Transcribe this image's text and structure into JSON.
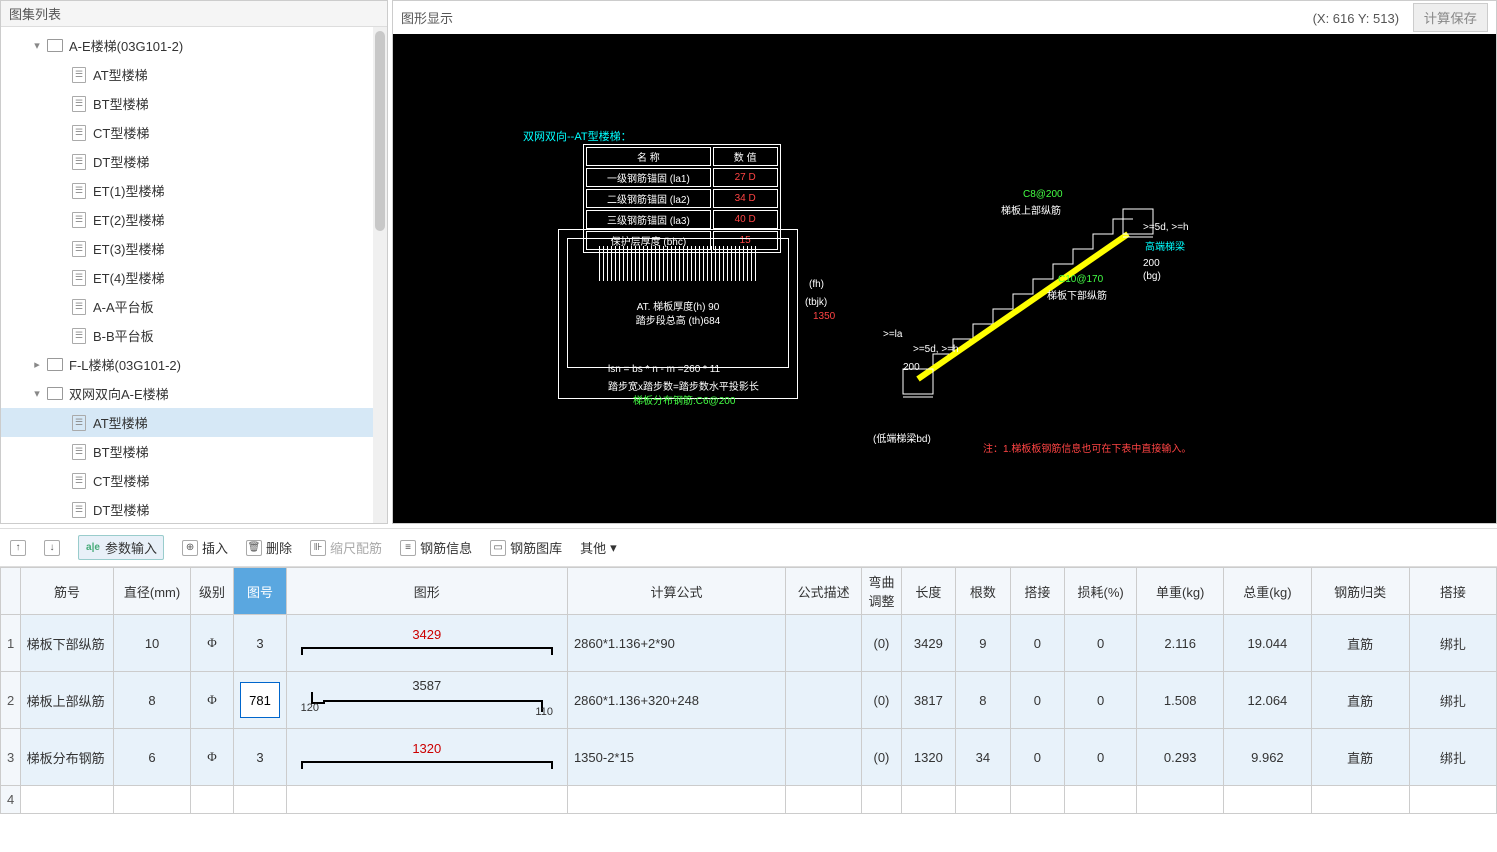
{
  "panels": {
    "tree_title": "图集列表",
    "graphic_title": "图形显示"
  },
  "coords": "(X: 616 Y: 513)",
  "calc_button": "计算保存",
  "tree": {
    "group1": {
      "label": "A-E楼梯(03G101-2)",
      "items": [
        "AT型楼梯",
        "BT型楼梯",
        "CT型楼梯",
        "DT型楼梯",
        "ET(1)型楼梯",
        "ET(2)型楼梯",
        "ET(3)型楼梯",
        "ET(4)型楼梯",
        "A-A平台板",
        "B-B平台板"
      ]
    },
    "group2": {
      "label": "F-L楼梯(03G101-2)"
    },
    "group3": {
      "label": "双网双向A-E楼梯",
      "items": [
        "AT型楼梯",
        "BT型楼梯",
        "CT型楼梯",
        "DT型楼梯"
      ]
    }
  },
  "cad": {
    "title": "双网双向--AT型楼梯：",
    "table_hdr_name": "名 称",
    "table_hdr_val": "数 值",
    "rows": [
      {
        "n": "一级钢筋锚固 (la1)",
        "v": "27 D"
      },
      {
        "n": "二级钢筋锚固 (la2)",
        "v": "34 D"
      },
      {
        "n": "三级钢筋锚固 (la3)",
        "v": "40 D"
      },
      {
        "n": "保护层厚度 (bhc)",
        "v": "15"
      }
    ],
    "h_label": "AT. 梯板厚度(h) 90",
    "th_label": "踏步段总高 (th)684",
    "fh_label": "(fh)",
    "tbjk_label": "(tbjk)",
    "tbjk_val": "1350",
    "lsn_label": "lsn = bs * n - m =260 * 11",
    "lsn_desc": "踏步宽x踏步数=踏步数水平投影长",
    "dist_rebar": "梯板分布钢筋:C6@200",
    "upper_rebar_code": "C8@200",
    "upper_rebar": "梯板上部纵筋",
    "lower_rebar_code": "C10@170",
    "lower_rebar": "梯板下部纵筋",
    "high_beam": "高端梯梁",
    "low_beam": "(低端梯梁bd)",
    "note": "注：1.梯板板钢筋信息也可在下表中直接输入。",
    "dim_200": "200",
    "dim_bg": "(bg)",
    "dim_la": ">=la",
    "dim_5dh": ">=5d, >=h"
  },
  "toolbar": {
    "up": "↑",
    "down": "↓",
    "param": "参数输入",
    "insert": "插入",
    "delete": "删除",
    "scale": "缩尺配筋",
    "info": "钢筋信息",
    "lib": "钢筋图库",
    "other": "其他"
  },
  "grid": {
    "headers": [
      "筋号",
      "直径(mm)",
      "级别",
      "图号",
      "图形",
      "计算公式",
      "公式描述",
      "弯曲调整",
      "长度",
      "根数",
      "搭接",
      "损耗(%)",
      "单重(kg)",
      "总重(kg)",
      "钢筋归类",
      "搭接"
    ],
    "rows": [
      {
        "name": "梯板下部纵筋",
        "dia": "10",
        "lvl": "Φ",
        "fig": "3",
        "shape": {
          "type": "line",
          "main": "3429"
        },
        "formula": "2860*1.136+2*90",
        "desc": "",
        "bend": "(0)",
        "len": "3429",
        "cnt": "9",
        "lap": "0",
        "loss": "0",
        "uw": "2.116",
        "tw": "19.044",
        "cat": "直筋",
        "tie": "绑扎"
      },
      {
        "name": "梯板上部纵筋",
        "dia": "8",
        "lvl": "Φ",
        "fig": "781",
        "shape": {
          "type": "hook",
          "main": "3587",
          "l": "120",
          "r": "110"
        },
        "formula": "2860*1.136+320+248",
        "desc": "",
        "bend": "(0)",
        "len": "3817",
        "cnt": "8",
        "lap": "0",
        "loss": "0",
        "uw": "1.508",
        "tw": "12.064",
        "cat": "直筋",
        "tie": "绑扎"
      },
      {
        "name": "梯板分布钢筋",
        "dia": "6",
        "lvl": "Φ",
        "fig": "3",
        "shape": {
          "type": "line",
          "main": "1320"
        },
        "formula": "1350-2*15",
        "desc": "",
        "bend": "(0)",
        "len": "1320",
        "cnt": "34",
        "lap": "0",
        "loss": "0",
        "uw": "0.293",
        "tw": "9.962",
        "cat": "直筋",
        "tie": "绑扎"
      }
    ]
  }
}
